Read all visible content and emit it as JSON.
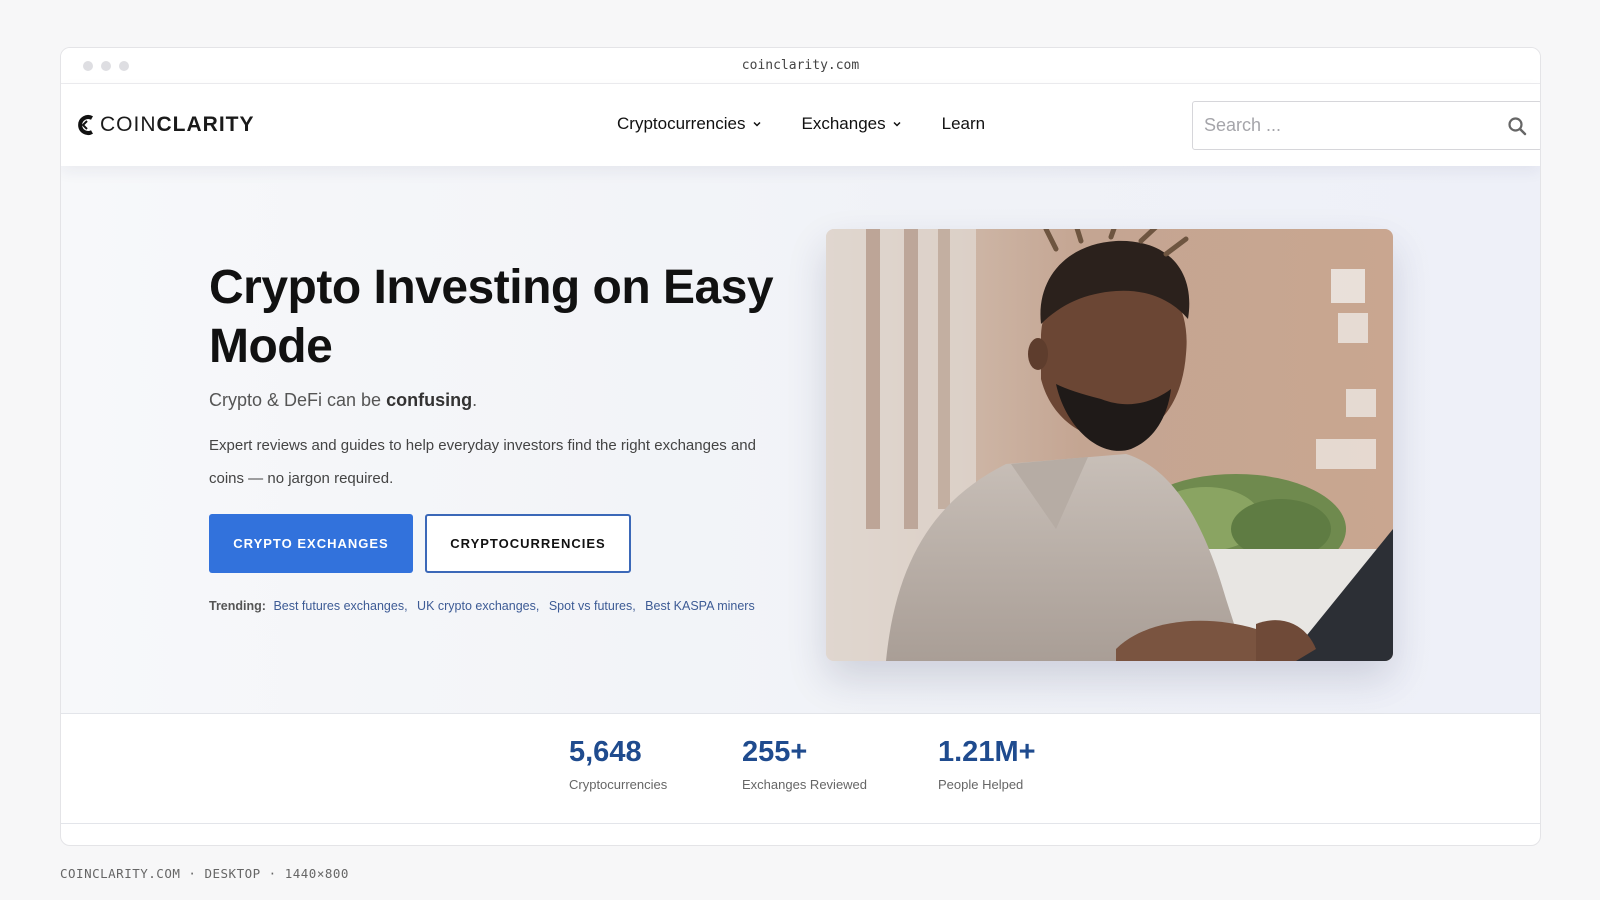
{
  "browser": {
    "url": "coinclarity.com"
  },
  "nav": {
    "logo_thin": "COIN",
    "logo_bold": "CLARITY",
    "items": [
      {
        "label": "Cryptocurrencies"
      },
      {
        "label": "Exchanges"
      },
      {
        "label": "Learn"
      }
    ],
    "search_placeholder": "Search ..."
  },
  "hero": {
    "title": "Crypto Investing on Easy Mode",
    "subtitle_prefix": "Crypto & DeFi can be ",
    "subtitle_bold": "confusing",
    "subtitle_suffix": ".",
    "description": "Expert reviews and guides to help everyday investors find the right exchanges and coins — no jargon required.",
    "primary_button": "CRYPTO EXCHANGES",
    "secondary_button": "CRYPTOCURRENCIES",
    "trending_label": "Trending:",
    "trending_links": [
      "Best futures exchanges",
      "UK crypto exchanges",
      "Spot vs futures",
      "Best KASPA miners"
    ]
  },
  "stats": [
    {
      "value": "5,648",
      "label": "Cryptocurrencies"
    },
    {
      "value": "255+",
      "label": "Exchanges Reviewed"
    },
    {
      "value": "1.21M+",
      "label": "People Helped"
    }
  ],
  "caption": "COINCLARITY.COM · DESKTOP · 1440×800",
  "colors": {
    "accent": "#3272dc",
    "stat_number": "#1f4b8e",
    "link": "#3d5b95"
  }
}
